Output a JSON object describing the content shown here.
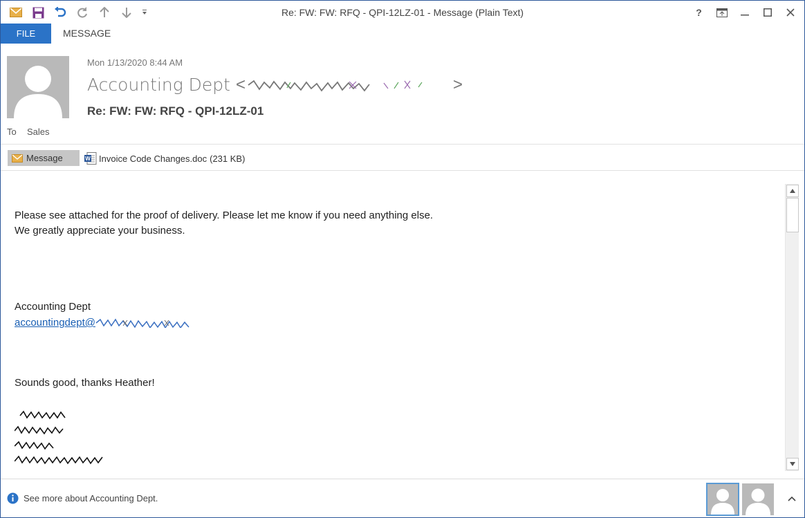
{
  "window": {
    "title": "Re: FW: FW: RFQ - QPI-12LZ-01 - Message (Plain Text)",
    "help_label": "?"
  },
  "quick_access": {
    "icons": [
      "envelope-icon",
      "save-icon",
      "undo-icon",
      "redo-icon",
      "up-arrow-icon",
      "down-arrow-icon",
      "customize-icon"
    ]
  },
  "ribbon": {
    "file_tab": "FILE",
    "message_tab": "MESSAGE"
  },
  "header": {
    "date": "Mon 1/13/2020 8:44 AM",
    "sender_name": "Accounting Dept",
    "sender_email_open": "<",
    "sender_email_close": ">",
    "subject": "Re: FW: FW: RFQ - QPI-12LZ-01",
    "to_label": "To",
    "to_value": "Sales"
  },
  "attachments": {
    "message_tab": "Message",
    "file_name": "Invoice Code Changes.doc",
    "file_size": "(231 KB)"
  },
  "body": {
    "line1": "Please see attached for the proof of delivery. Please let me know if you need anything else.",
    "line2": "We greatly appreciate your business.",
    "signature_name": "Accounting Dept",
    "signature_email_prefix": "accountingdept@",
    "reply_line": "Sounds good, thanks Heather!"
  },
  "status": {
    "text": "See more about Accounting Dept."
  },
  "colors": {
    "file_tab": "#2b73c7",
    "accent_border": "#2b579a",
    "link": "#1a5fb4",
    "avatar_bg": "#b9b9b9"
  }
}
